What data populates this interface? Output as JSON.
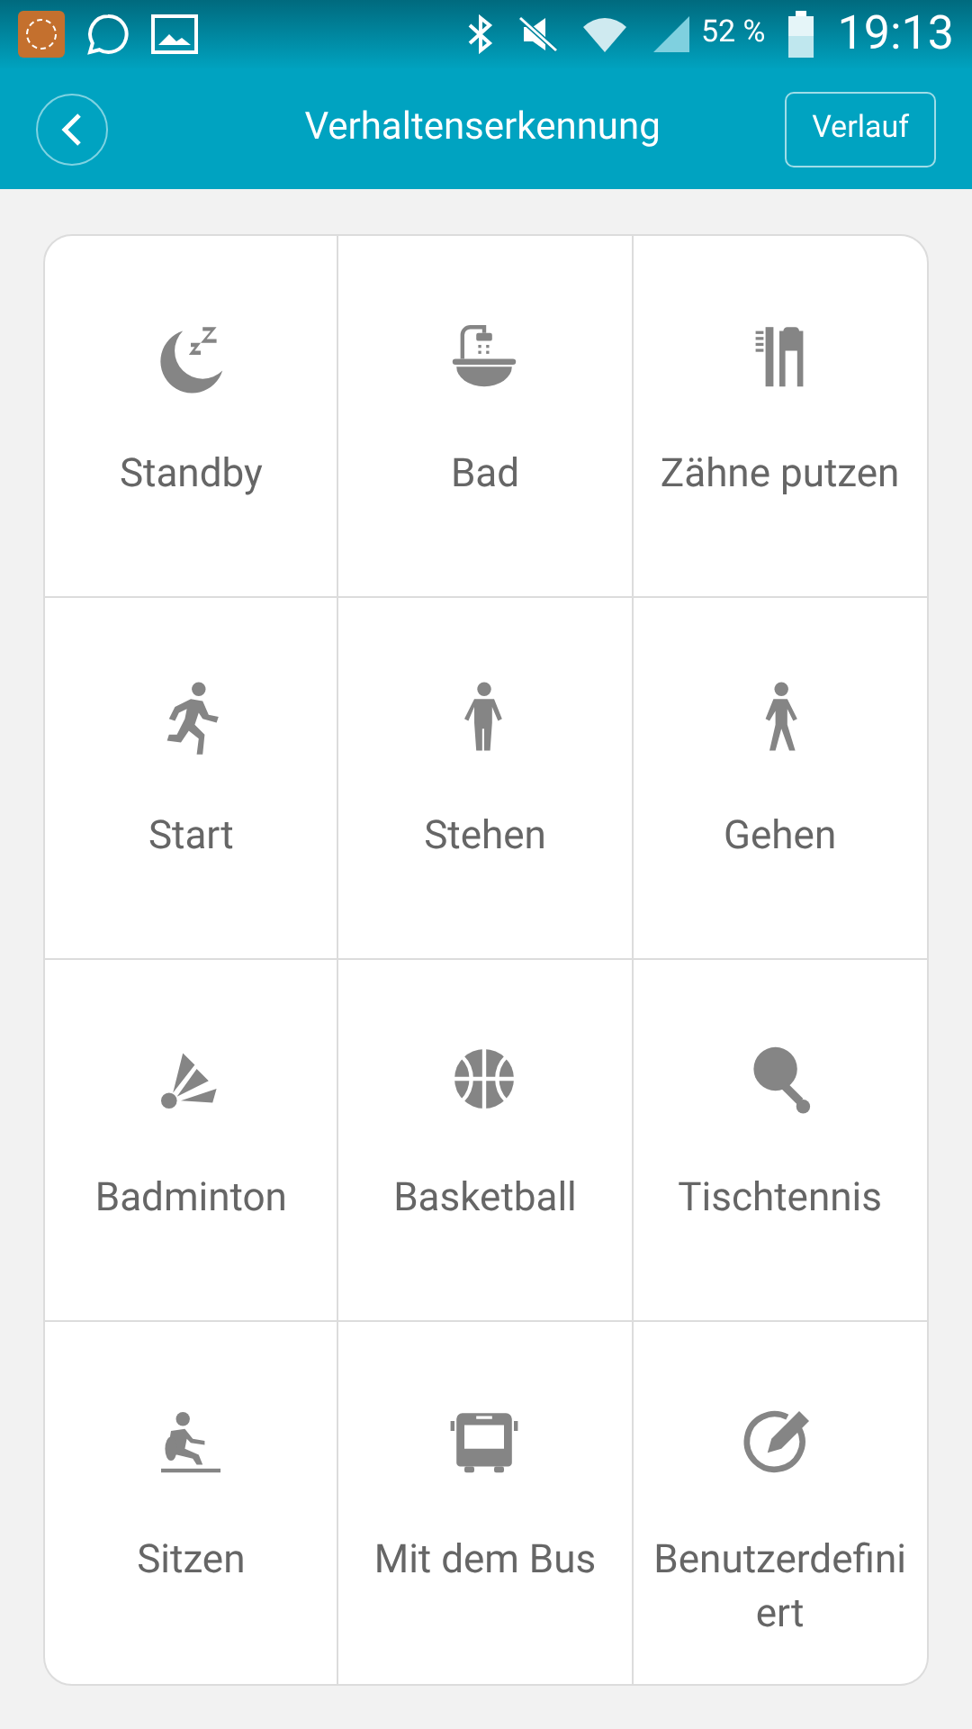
{
  "status_bar": {
    "battery_text": "52 %",
    "time": "19:13"
  },
  "header": {
    "title": "Verhaltenserkennung",
    "action": "Verlauf"
  },
  "activities": [
    {
      "label": "Standby"
    },
    {
      "label": "Bad"
    },
    {
      "label": "Zähne putzen"
    },
    {
      "label": "Start"
    },
    {
      "label": "Stehen"
    },
    {
      "label": "Gehen"
    },
    {
      "label": "Badminton"
    },
    {
      "label": "Basketball"
    },
    {
      "label": "Tischtennis"
    },
    {
      "label": "Sitzen"
    },
    {
      "label": "Mit dem Bus"
    },
    {
      "label": "Benutzerdefiniert"
    }
  ]
}
